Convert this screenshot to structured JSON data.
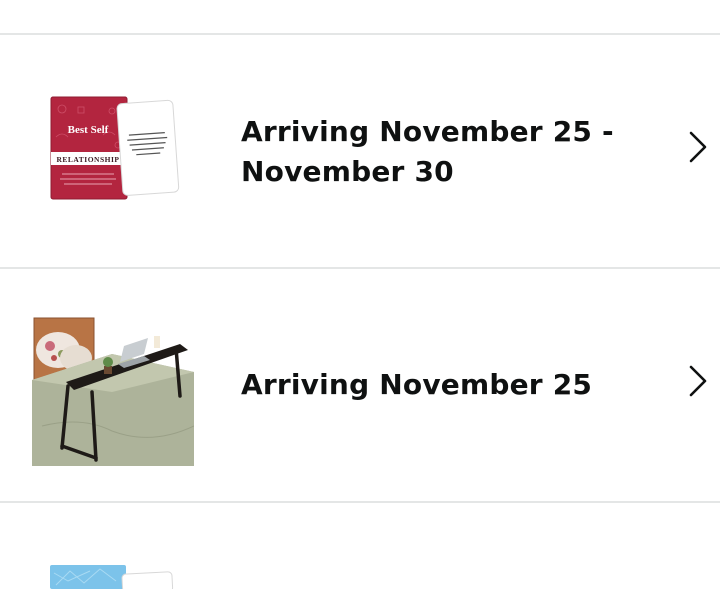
{
  "orders": [
    {
      "status_line1": "Arriving November 25 -",
      "status_line2": "November 30",
      "product": {
        "brand": "Best Self",
        "title": "RELATIONSHIP",
        "card_text": "Does it matter if one person cares more than the other in our relationship?",
        "box_subtext": "Use these prompts to talk about what matters to you, see how to belong in a healthy, honest and real, build stronger"
      },
      "icon": "chevron-right-icon"
    },
    {
      "status": "Arriving November 25",
      "product": {
        "image": "overbed-table-photo"
      },
      "icon": "chevron-right-icon"
    },
    {
      "product": {
        "image": "blue-card-box-photo"
      }
    }
  ],
  "colors": {
    "divider": "#e4e6e6",
    "text": "#0f1111",
    "box_red": "#b3253f",
    "box_blue": "#7cc3ea"
  }
}
